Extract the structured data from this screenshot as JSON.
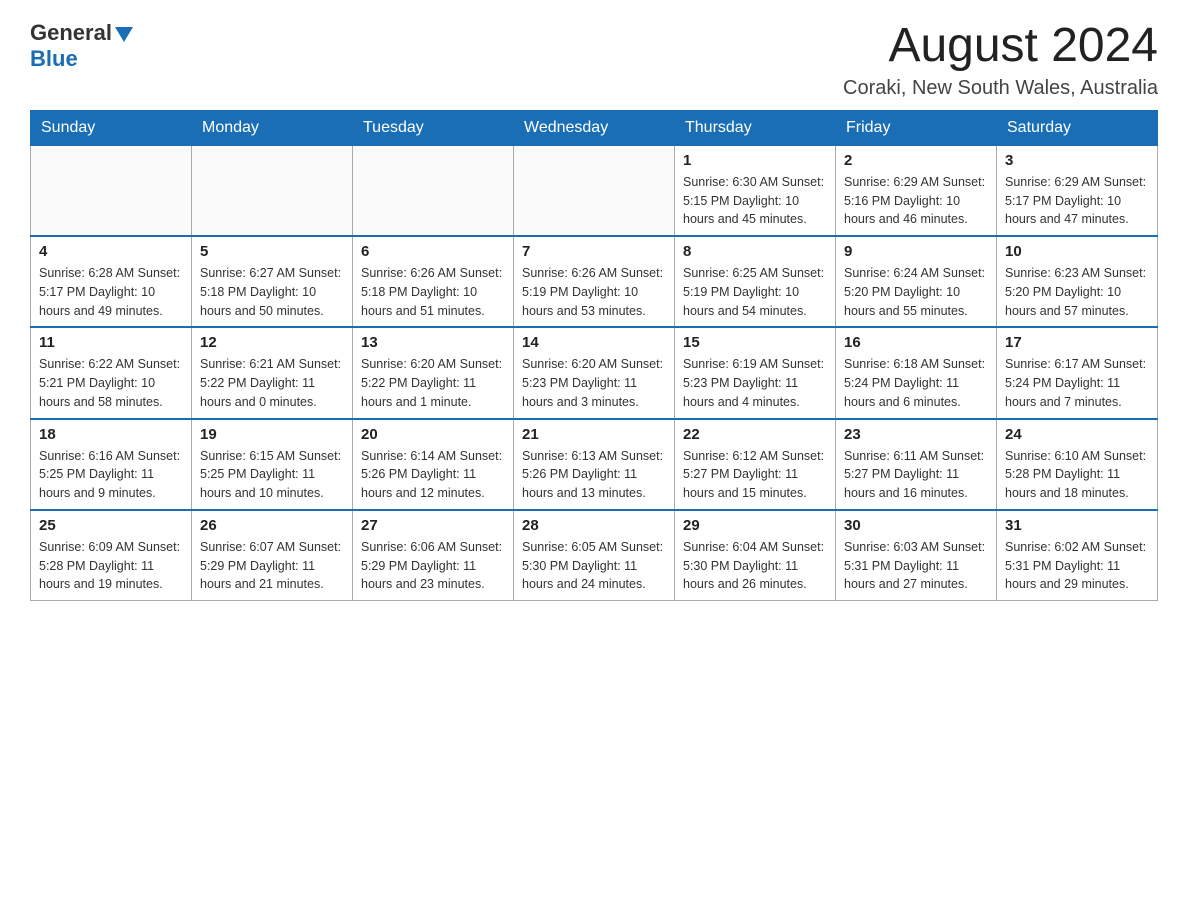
{
  "header": {
    "logo_general": "General",
    "logo_blue": "Blue",
    "month_title": "August 2024",
    "location": "Coraki, New South Wales, Australia"
  },
  "calendar": {
    "days_of_week": [
      "Sunday",
      "Monday",
      "Tuesday",
      "Wednesday",
      "Thursday",
      "Friday",
      "Saturday"
    ],
    "weeks": [
      [
        {
          "day": "",
          "info": ""
        },
        {
          "day": "",
          "info": ""
        },
        {
          "day": "",
          "info": ""
        },
        {
          "day": "",
          "info": ""
        },
        {
          "day": "1",
          "info": "Sunrise: 6:30 AM\nSunset: 5:15 PM\nDaylight: 10 hours\nand 45 minutes."
        },
        {
          "day": "2",
          "info": "Sunrise: 6:29 AM\nSunset: 5:16 PM\nDaylight: 10 hours\nand 46 minutes."
        },
        {
          "day": "3",
          "info": "Sunrise: 6:29 AM\nSunset: 5:17 PM\nDaylight: 10 hours\nand 47 minutes."
        }
      ],
      [
        {
          "day": "4",
          "info": "Sunrise: 6:28 AM\nSunset: 5:17 PM\nDaylight: 10 hours\nand 49 minutes."
        },
        {
          "day": "5",
          "info": "Sunrise: 6:27 AM\nSunset: 5:18 PM\nDaylight: 10 hours\nand 50 minutes."
        },
        {
          "day": "6",
          "info": "Sunrise: 6:26 AM\nSunset: 5:18 PM\nDaylight: 10 hours\nand 51 minutes."
        },
        {
          "day": "7",
          "info": "Sunrise: 6:26 AM\nSunset: 5:19 PM\nDaylight: 10 hours\nand 53 minutes."
        },
        {
          "day": "8",
          "info": "Sunrise: 6:25 AM\nSunset: 5:19 PM\nDaylight: 10 hours\nand 54 minutes."
        },
        {
          "day": "9",
          "info": "Sunrise: 6:24 AM\nSunset: 5:20 PM\nDaylight: 10 hours\nand 55 minutes."
        },
        {
          "day": "10",
          "info": "Sunrise: 6:23 AM\nSunset: 5:20 PM\nDaylight: 10 hours\nand 57 minutes."
        }
      ],
      [
        {
          "day": "11",
          "info": "Sunrise: 6:22 AM\nSunset: 5:21 PM\nDaylight: 10 hours\nand 58 minutes."
        },
        {
          "day": "12",
          "info": "Sunrise: 6:21 AM\nSunset: 5:22 PM\nDaylight: 11 hours\nand 0 minutes."
        },
        {
          "day": "13",
          "info": "Sunrise: 6:20 AM\nSunset: 5:22 PM\nDaylight: 11 hours\nand 1 minute."
        },
        {
          "day": "14",
          "info": "Sunrise: 6:20 AM\nSunset: 5:23 PM\nDaylight: 11 hours\nand 3 minutes."
        },
        {
          "day": "15",
          "info": "Sunrise: 6:19 AM\nSunset: 5:23 PM\nDaylight: 11 hours\nand 4 minutes."
        },
        {
          "day": "16",
          "info": "Sunrise: 6:18 AM\nSunset: 5:24 PM\nDaylight: 11 hours\nand 6 minutes."
        },
        {
          "day": "17",
          "info": "Sunrise: 6:17 AM\nSunset: 5:24 PM\nDaylight: 11 hours\nand 7 minutes."
        }
      ],
      [
        {
          "day": "18",
          "info": "Sunrise: 6:16 AM\nSunset: 5:25 PM\nDaylight: 11 hours\nand 9 minutes."
        },
        {
          "day": "19",
          "info": "Sunrise: 6:15 AM\nSunset: 5:25 PM\nDaylight: 11 hours\nand 10 minutes."
        },
        {
          "day": "20",
          "info": "Sunrise: 6:14 AM\nSunset: 5:26 PM\nDaylight: 11 hours\nand 12 minutes."
        },
        {
          "day": "21",
          "info": "Sunrise: 6:13 AM\nSunset: 5:26 PM\nDaylight: 11 hours\nand 13 minutes."
        },
        {
          "day": "22",
          "info": "Sunrise: 6:12 AM\nSunset: 5:27 PM\nDaylight: 11 hours\nand 15 minutes."
        },
        {
          "day": "23",
          "info": "Sunrise: 6:11 AM\nSunset: 5:27 PM\nDaylight: 11 hours\nand 16 minutes."
        },
        {
          "day": "24",
          "info": "Sunrise: 6:10 AM\nSunset: 5:28 PM\nDaylight: 11 hours\nand 18 minutes."
        }
      ],
      [
        {
          "day": "25",
          "info": "Sunrise: 6:09 AM\nSunset: 5:28 PM\nDaylight: 11 hours\nand 19 minutes."
        },
        {
          "day": "26",
          "info": "Sunrise: 6:07 AM\nSunset: 5:29 PM\nDaylight: 11 hours\nand 21 minutes."
        },
        {
          "day": "27",
          "info": "Sunrise: 6:06 AM\nSunset: 5:29 PM\nDaylight: 11 hours\nand 23 minutes."
        },
        {
          "day": "28",
          "info": "Sunrise: 6:05 AM\nSunset: 5:30 PM\nDaylight: 11 hours\nand 24 minutes."
        },
        {
          "day": "29",
          "info": "Sunrise: 6:04 AM\nSunset: 5:30 PM\nDaylight: 11 hours\nand 26 minutes."
        },
        {
          "day": "30",
          "info": "Sunrise: 6:03 AM\nSunset: 5:31 PM\nDaylight: 11 hours\nand 27 minutes."
        },
        {
          "day": "31",
          "info": "Sunrise: 6:02 AM\nSunset: 5:31 PM\nDaylight: 11 hours\nand 29 minutes."
        }
      ]
    ]
  }
}
